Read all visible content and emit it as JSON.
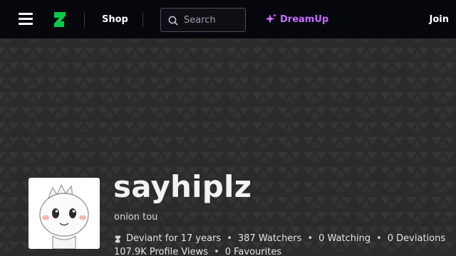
{
  "header": {
    "shop_label": "Shop",
    "search_placeholder": "Search",
    "dreamup_label": "DreamUp",
    "join_label": "Join"
  },
  "colors": {
    "topbar": "#06070d",
    "brand_green": "#05cc47",
    "dreamup_purple": "#c86bff",
    "banner_bg": "#2b2b2b"
  },
  "icons": [
    "menu-icon",
    "deviantart-logo-icon",
    "search-icon",
    "sparkles-icon"
  ],
  "profile": {
    "username": "sayhiplz",
    "tagline": "onion tou",
    "stats": {
      "deviant_for": "Deviant for 17 years",
      "watchers": "387 Watchers",
      "watching": "0 Watching",
      "deviations": "0 Deviations",
      "profile_views": "107.9K Profile Views",
      "favourites": "0 Favourites"
    }
  }
}
